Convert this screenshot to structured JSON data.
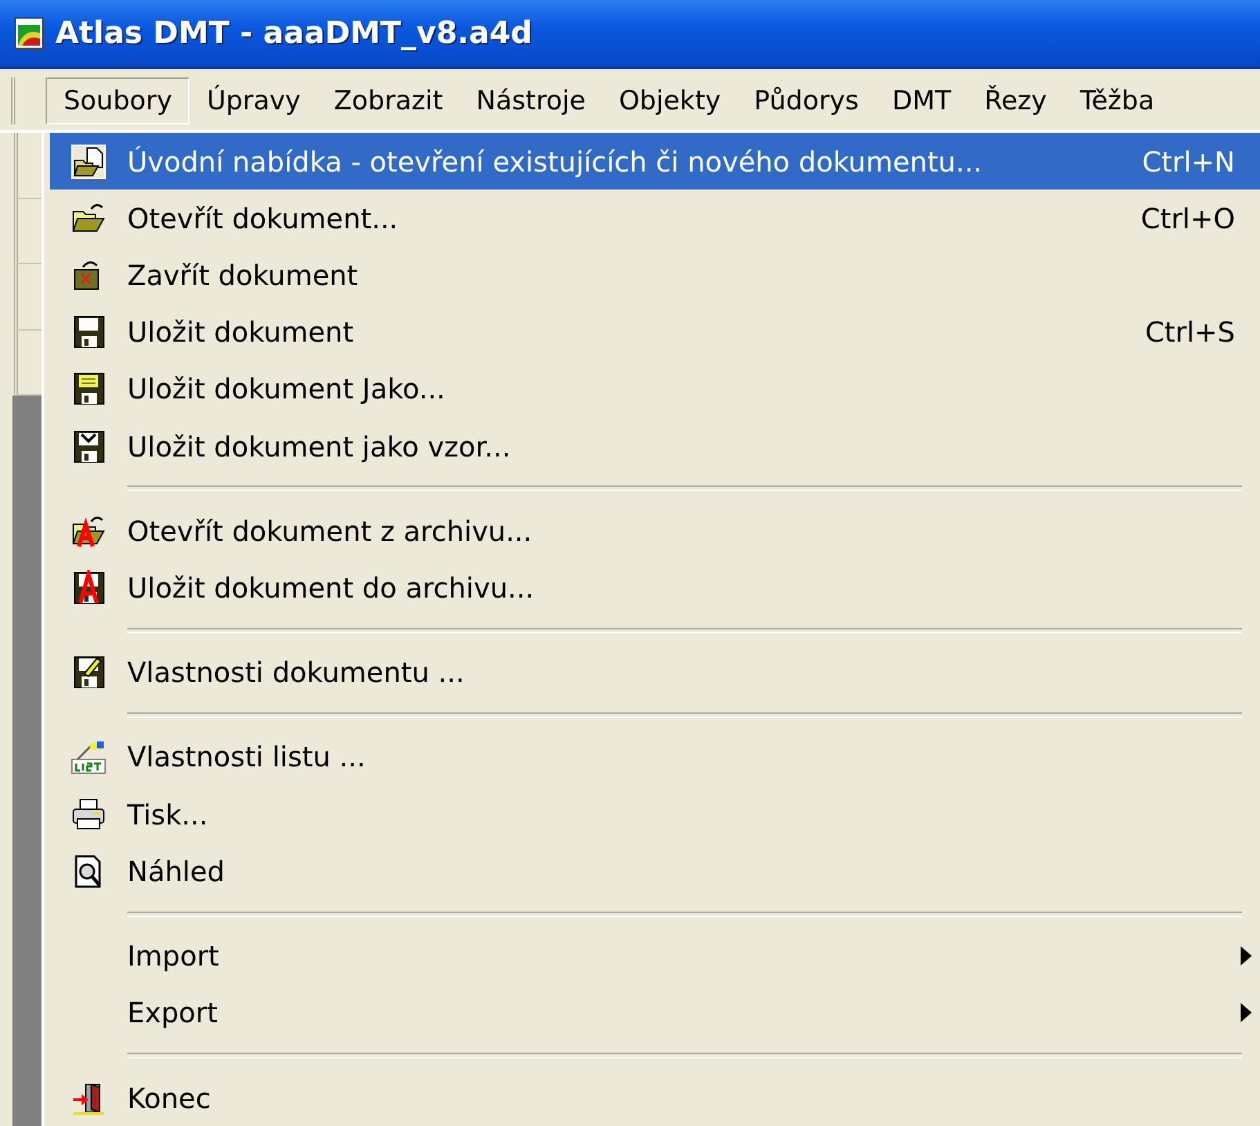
{
  "window": {
    "title": "Atlas DMT - aaaDMT_v8.a4d"
  },
  "menubar": [
    {
      "label": "Soubory",
      "selected": true
    },
    {
      "label": "Úpravy",
      "selected": false
    },
    {
      "label": "Zobrazit",
      "selected": false
    },
    {
      "label": "Nástroje",
      "selected": false
    },
    {
      "label": "Objekty",
      "selected": false
    },
    {
      "label": "Půdorys",
      "selected": false
    },
    {
      "label": "DMT",
      "selected": false
    },
    {
      "label": "Řezy",
      "selected": false
    },
    {
      "label": "Těžba",
      "selected": false
    }
  ],
  "menu": [
    {
      "kind": "item",
      "label": "Úvodní nabídka - otevření existujících či nového dokumentu...",
      "shortcut": "Ctrl+N",
      "selected": true
    },
    {
      "kind": "item",
      "label": "Otevřít dokument...",
      "shortcut": "Ctrl+O",
      "selected": false
    },
    {
      "kind": "item",
      "label": "Zavřít dokument",
      "selected": false
    },
    {
      "kind": "item",
      "label": "Uložit dokument",
      "shortcut": "Ctrl+S",
      "selected": false
    },
    {
      "kind": "item",
      "label": "Uložit dokument Jako...",
      "selected": false
    },
    {
      "kind": "item",
      "label": "Uložit dokument jako vzor...",
      "selected": false
    },
    {
      "kind": "separator"
    },
    {
      "kind": "item",
      "label": "Otevřít dokument z archivu...",
      "selected": false
    },
    {
      "kind": "item",
      "label": "Uložit dokument do archivu...",
      "selected": false
    },
    {
      "kind": "separator"
    },
    {
      "kind": "item",
      "label": "Vlastnosti dokumentu ...",
      "selected": false
    },
    {
      "kind": "separator"
    },
    {
      "kind": "item",
      "label": "Vlastnosti listu ...",
      "selected": false
    },
    {
      "kind": "item",
      "label": "Tisk...",
      "selected": false
    },
    {
      "kind": "item",
      "label": "Náhled",
      "selected": false
    },
    {
      "kind": "separator"
    },
    {
      "kind": "submenu",
      "label": "Import",
      "selected": false
    },
    {
      "kind": "submenu",
      "label": "Export",
      "selected": false
    },
    {
      "kind": "separator"
    },
    {
      "kind": "item",
      "label": "Konec",
      "selected": false
    }
  ]
}
